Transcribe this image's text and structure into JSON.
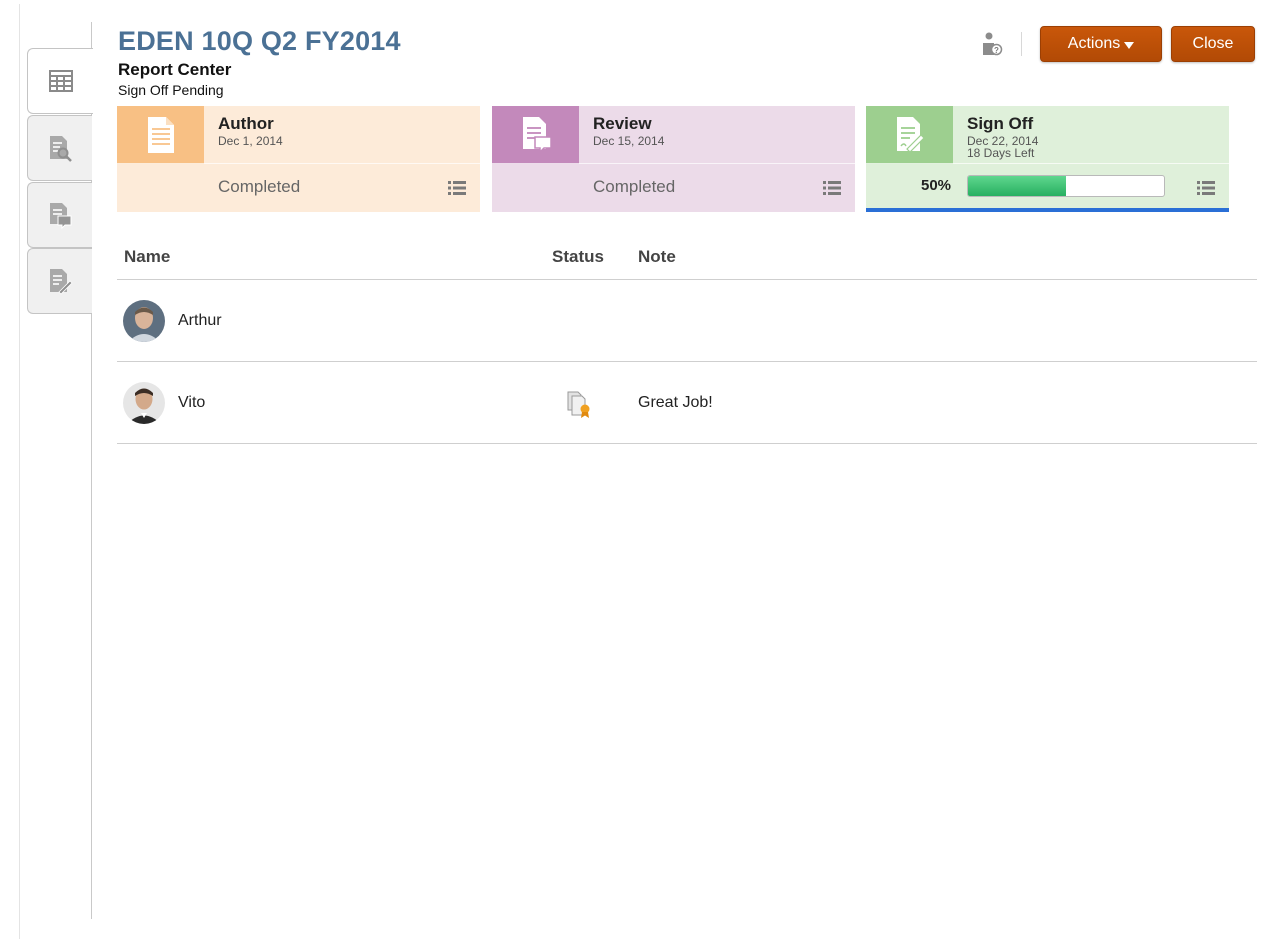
{
  "header": {
    "title": "EDEN 10Q Q2 FY2014",
    "subtitle": "Report Center",
    "status": "Sign Off Pending",
    "actions_label": "Actions",
    "close_label": "Close"
  },
  "tabs": [
    {
      "icon": "grid-icon",
      "active": true
    },
    {
      "icon": "document-search-icon",
      "active": false
    },
    {
      "icon": "document-comment-icon",
      "active": false
    },
    {
      "icon": "document-sign-icon",
      "active": false
    }
  ],
  "phases": {
    "author": {
      "name": "Author",
      "date": "Dec 1, 2014",
      "state": "Completed",
      "color": "#f8c084"
    },
    "review": {
      "name": "Review",
      "date": "Dec 15, 2014",
      "state": "Completed",
      "color": "#c389bb"
    },
    "signoff": {
      "name": "Sign Off",
      "date": "Dec 22, 2014",
      "days_left": "18 Days Left",
      "progress_label": "50%",
      "progress": 0.5,
      "color": "#9dcf8f"
    }
  },
  "table": {
    "columns": {
      "name": "Name",
      "status": "Status",
      "note": "Note"
    },
    "rows": [
      {
        "name": "Arthur",
        "status_icon": "",
        "note": ""
      },
      {
        "name": "Vito",
        "status_icon": "signed-certificate-icon",
        "note": "Great Job!"
      }
    ]
  },
  "colors": {
    "title": "#4b7195",
    "button": "#c9570a",
    "active_phase_underline": "#2a6fd6"
  }
}
